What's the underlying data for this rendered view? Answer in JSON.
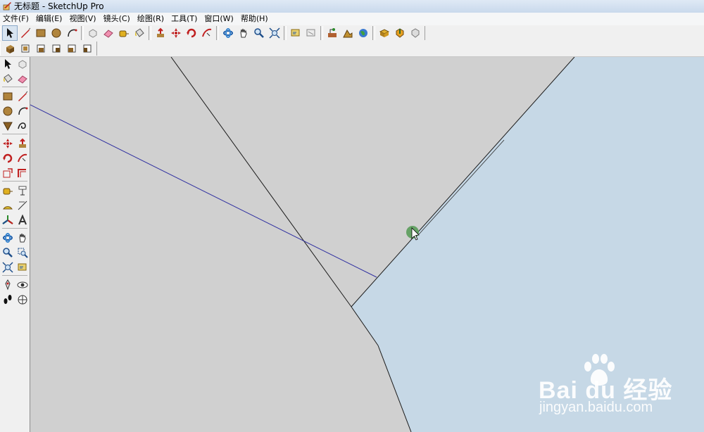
{
  "window": {
    "title": "无标题 - SketchUp Pro"
  },
  "menu": [
    "文件(F)",
    "编辑(E)",
    "视图(V)",
    "镜头(C)",
    "绘图(R)",
    "工具(T)",
    "窗口(W)",
    "帮助(H)"
  ],
  "toolbar_top": [
    [
      "select-tool-icon",
      "line-tool-icon",
      "rectangle-tool-icon",
      "circle-tool-icon",
      "arc-tool-icon"
    ],
    [
      "make-component-icon",
      "eraser-icon",
      "tape-measure-icon",
      "paint-bucket-icon"
    ],
    [
      "push-pull-icon",
      "move-icon",
      "rotate-icon",
      "follow-me-icon"
    ],
    [
      "orbit-icon",
      "pan-icon",
      "zoom-icon",
      "zoom-extents-icon"
    ],
    [
      "previous-view-icon",
      "next-view-icon"
    ],
    [
      "add-location-icon",
      "toggle-terrain-icon",
      "google-earth-icon"
    ],
    [
      "get-models-icon",
      "share-model-icon",
      "share-component-icon"
    ]
  ],
  "toolbar_views": [
    "iso-view-icon",
    "top-view-icon",
    "front-view-icon",
    "right-view-icon",
    "back-view-icon",
    "left-view-icon"
  ],
  "left_toolbar": [
    [
      "select-tool-icon",
      "make-component-icon"
    ],
    [
      "paint-bucket-icon",
      "eraser-icon"
    ],
    "sep",
    [
      "rectangle-tool-icon",
      "line-tool-icon"
    ],
    [
      "circle-tool-icon",
      "arc-tool-icon"
    ],
    [
      "polygon-tool-icon",
      "freehand-tool-icon"
    ],
    "sep",
    [
      "move-icon",
      "push-pull-icon"
    ],
    [
      "rotate-icon",
      "follow-me-icon"
    ],
    [
      "scale-icon",
      "offset-icon"
    ],
    "sep",
    [
      "tape-measure-icon",
      "dimensions-icon"
    ],
    [
      "protractor-icon",
      "text-tool-icon"
    ],
    [
      "axes-icon",
      "3d-text-icon"
    ],
    "sep",
    [
      "orbit-icon",
      "pan-icon"
    ],
    [
      "zoom-icon",
      "zoom-window-icon"
    ],
    [
      "zoom-extents-icon",
      "previous-view-icon"
    ],
    "sep",
    [
      "position-camera-icon",
      "look-around-icon"
    ],
    [
      "walk-icon",
      "section-plane-icon"
    ]
  ],
  "colors": {
    "model_face": "#d0d0d0",
    "sky_face": "#c6d8e6",
    "axis_line": "#3030a0",
    "cursor_marker": "#5a9c5a"
  },
  "watermark": {
    "brand": "Bai du 经验",
    "url": "jingyan.baidu.com"
  }
}
